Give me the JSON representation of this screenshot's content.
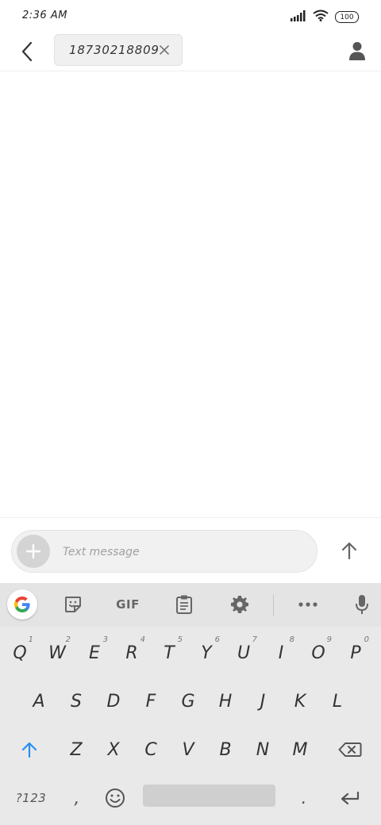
{
  "status_bar": {
    "time": "2:36 AM",
    "battery": "100"
  },
  "header": {
    "recipient": "18730218809"
  },
  "compose": {
    "placeholder": "Text message"
  },
  "keyboard": {
    "toolbar": {
      "gif_label": "GIF"
    },
    "row1": [
      {
        "key": "Q",
        "hint": "1"
      },
      {
        "key": "W",
        "hint": "2"
      },
      {
        "key": "E",
        "hint": "3"
      },
      {
        "key": "R",
        "hint": "4"
      },
      {
        "key": "T",
        "hint": "5"
      },
      {
        "key": "Y",
        "hint": "6"
      },
      {
        "key": "U",
        "hint": "7"
      },
      {
        "key": "I",
        "hint": "8"
      },
      {
        "key": "O",
        "hint": "9"
      },
      {
        "key": "P",
        "hint": "0"
      }
    ],
    "row2": [
      "A",
      "S",
      "D",
      "F",
      "G",
      "H",
      "J",
      "K",
      "L"
    ],
    "row3": [
      "Z",
      "X",
      "C",
      "V",
      "B",
      "N",
      "M"
    ],
    "row4": {
      "symbols": "?123",
      "comma": ",",
      "period": "."
    }
  },
  "colors": {
    "accent_blue": "#2a8ef0",
    "keyboard_bg": "#e9e9e9",
    "icon_gray": "#666666"
  }
}
